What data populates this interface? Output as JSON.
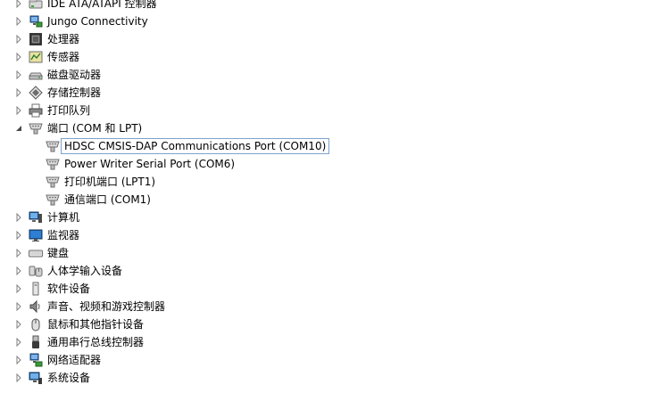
{
  "tree": {
    "items": [
      {
        "label": "IDE ATA/ATAPI 控制器",
        "expander": "collapsed",
        "icon": "ide-controller-icon"
      },
      {
        "label": "Jungo Connectivity",
        "expander": "collapsed",
        "icon": "network-device-icon"
      },
      {
        "label": "处理器",
        "expander": "collapsed",
        "icon": "processor-icon"
      },
      {
        "label": "传感器",
        "expander": "collapsed",
        "icon": "sensor-icon"
      },
      {
        "label": "磁盘驱动器",
        "expander": "collapsed",
        "icon": "disk-drive-icon"
      },
      {
        "label": "存储控制器",
        "expander": "collapsed",
        "icon": "storage-controller-icon"
      },
      {
        "label": "打印队列",
        "expander": "collapsed",
        "icon": "printer-icon"
      },
      {
        "label": "端口 (COM 和 LPT)",
        "expander": "expanded",
        "icon": "port-connector-icon"
      },
      {
        "label": "HDSC CMSIS-DAP Communications Port (COM10)",
        "expander": "none",
        "icon": "port-connector-icon",
        "selected": true
      },
      {
        "label": "Power Writer Serial Port (COM6)",
        "expander": "none",
        "icon": "port-connector-icon"
      },
      {
        "label": "打印机端口 (LPT1)",
        "expander": "none",
        "icon": "port-connector-icon"
      },
      {
        "label": "通信端口 (COM1)",
        "expander": "none",
        "icon": "port-connector-icon"
      },
      {
        "label": "计算机",
        "expander": "collapsed",
        "icon": "computer-icon"
      },
      {
        "label": "监视器",
        "expander": "collapsed",
        "icon": "monitor-icon"
      },
      {
        "label": "键盘",
        "expander": "collapsed",
        "icon": "keyboard-icon"
      },
      {
        "label": "人体学输入设备",
        "expander": "collapsed",
        "icon": "hid-icon"
      },
      {
        "label": "软件设备",
        "expander": "collapsed",
        "icon": "software-device-icon"
      },
      {
        "label": "声音、视频和游戏控制器",
        "expander": "collapsed",
        "icon": "speaker-icon"
      },
      {
        "label": "鼠标和其他指针设备",
        "expander": "collapsed",
        "icon": "mouse-icon"
      },
      {
        "label": "通用串行总线控制器",
        "expander": "collapsed",
        "icon": "usb-icon"
      },
      {
        "label": "网络适配器",
        "expander": "collapsed",
        "icon": "network-adapter-icon"
      },
      {
        "label": "系统设备",
        "expander": "collapsed",
        "icon": "system-device-icon"
      }
    ]
  },
  "colors": {
    "selection_border": "#7da2ce",
    "expander_stroke": "#7a7a7a",
    "text": "#000000",
    "background": "#ffffff"
  }
}
